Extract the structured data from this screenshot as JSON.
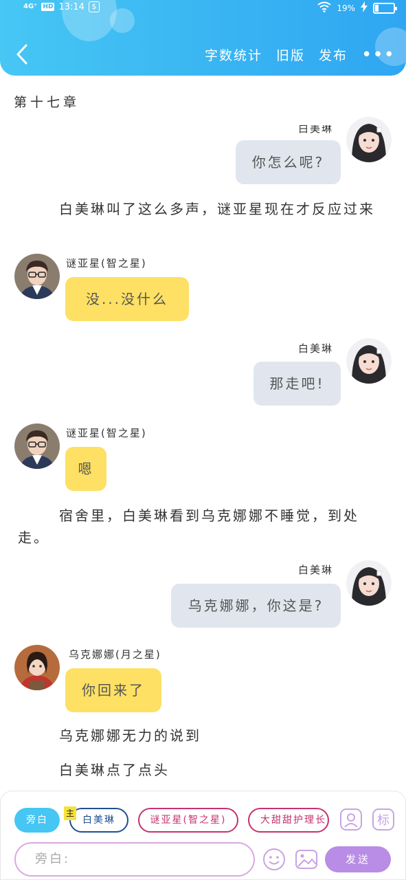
{
  "status_bar": {
    "network": "4G⁺",
    "hd": "HD",
    "time": "13:14",
    "battery": "19%",
    "battery_level": 0.19
  },
  "nav": {
    "word_count": "字数统计",
    "old_version": "旧版",
    "publish": "发布",
    "more": "•••"
  },
  "chapter_title": "第十七章",
  "messages": [
    {
      "name": "白美琳",
      "text": "你怎么呢?"
    },
    {
      "narration": "白美琳叫了这么多声，谜亚星现在才反应过来"
    },
    {
      "name": "谜亚星(智之星)",
      "text": "没...没什么"
    },
    {
      "name": "白美琳",
      "text": "那走吧!"
    },
    {
      "name": "谜亚星(智之星)",
      "text": "嗯"
    },
    {
      "narration": "宿舍里，白美琳看到乌克娜娜不睡觉，到处走。"
    },
    {
      "name": "白美琳",
      "text": "乌克娜娜，你这是?"
    },
    {
      "name": "乌克娜娜(月之星)",
      "text": "你回来了"
    },
    {
      "narration": "乌克娜娜无力的说到"
    },
    {
      "narration": "白美琳点了点头"
    }
  ],
  "composer": {
    "role_chips": [
      "旁白",
      "白美琳",
      "谜亚星(智之星)",
      "大甜甜护理长"
    ],
    "main_tag": "主",
    "input_placeholder": "旁白:",
    "send_label": "发送",
    "tag_icon_label": "标"
  },
  "colors": {
    "header_gradient": [
      "#46c7f4",
      "#2fa6f2"
    ],
    "right_bubble": "#e1e6ee",
    "left_bubble": "#fde064",
    "send": "#b98ce6"
  }
}
